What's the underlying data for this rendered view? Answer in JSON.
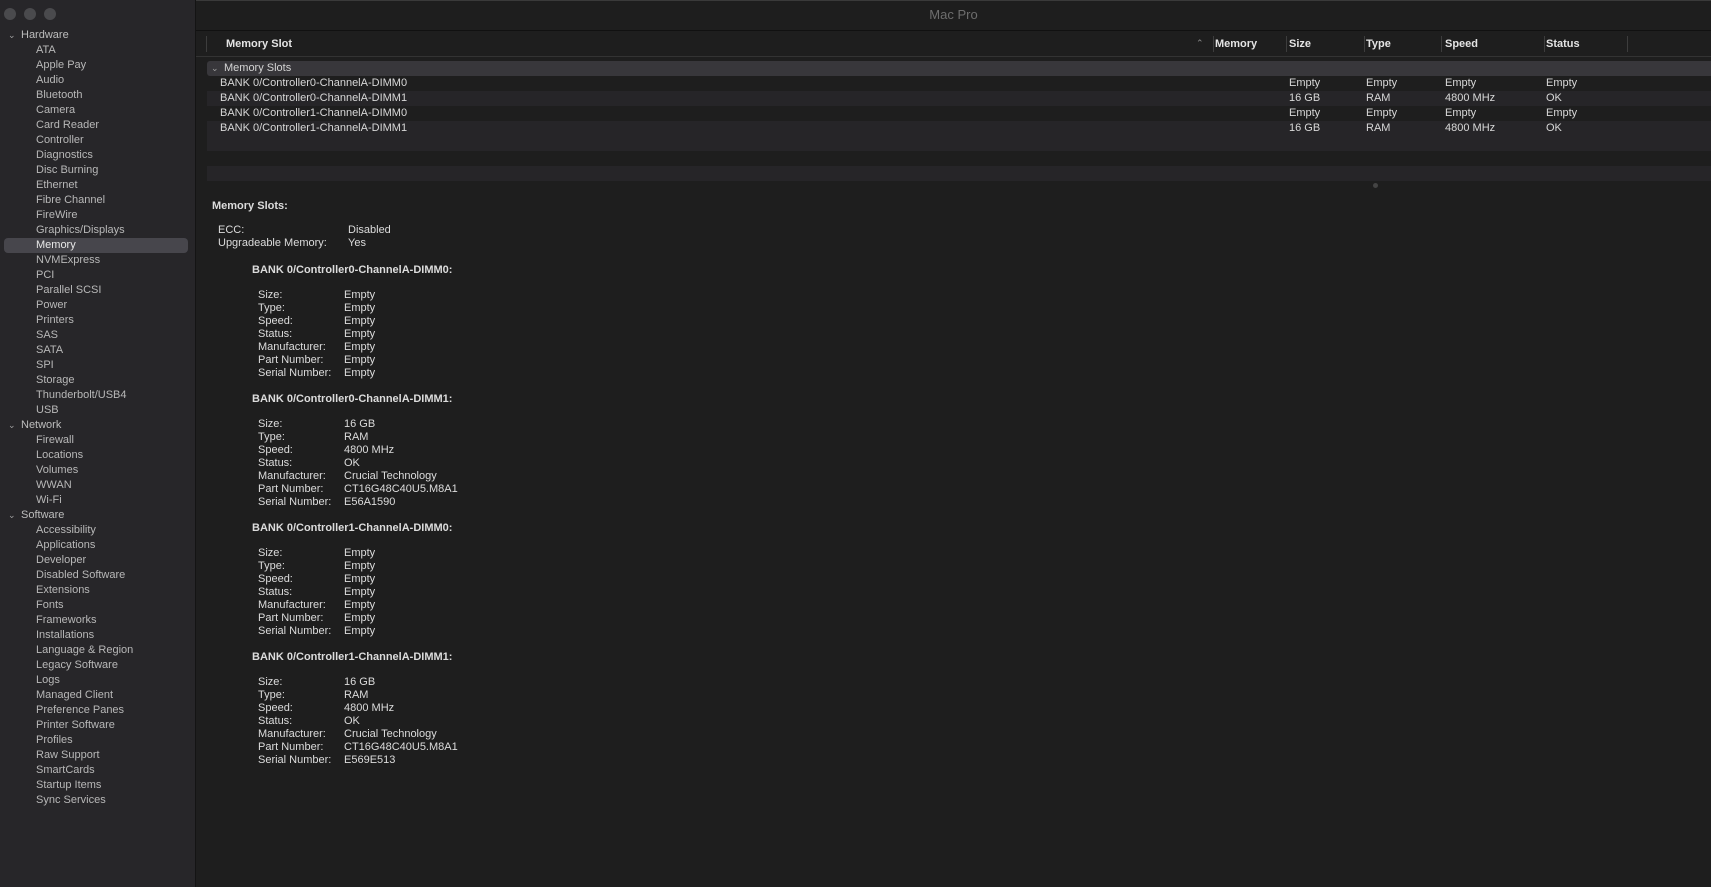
{
  "window": {
    "title": "Mac Pro"
  },
  "sidebar": {
    "sections": [
      {
        "label": "Hardware",
        "items": [
          "ATA",
          "Apple Pay",
          "Audio",
          "Bluetooth",
          "Camera",
          "Card Reader",
          "Controller",
          "Diagnostics",
          "Disc Burning",
          "Ethernet",
          "Fibre Channel",
          "FireWire",
          "Graphics/Displays",
          "Memory",
          "NVMExpress",
          "PCI",
          "Parallel SCSI",
          "Power",
          "Printers",
          "SAS",
          "SATA",
          "SPI",
          "Storage",
          "Thunderbolt/USB4",
          "USB"
        ]
      },
      {
        "label": "Network",
        "items": [
          "Firewall",
          "Locations",
          "Volumes",
          "WWAN",
          "Wi-Fi"
        ]
      },
      {
        "label": "Software",
        "items": [
          "Accessibility",
          "Applications",
          "Developer",
          "Disabled Software",
          "Extensions",
          "Fonts",
          "Frameworks",
          "Installations",
          "Language & Region",
          "Legacy Software",
          "Logs",
          "Managed Client",
          "Preference Panes",
          "Printer Software",
          "Profiles",
          "Raw Support",
          "SmartCards",
          "Startup Items",
          "Sync Services"
        ]
      }
    ],
    "selected": "Memory"
  },
  "table": {
    "columns": [
      "Memory Slot",
      "Memory",
      "Size",
      "Type",
      "Speed",
      "Status"
    ],
    "group_label": "Memory Slots",
    "rows": [
      {
        "slot": "BANK 0/Controller0-ChannelA-DIMM0",
        "memory": "",
        "size": "Empty",
        "type": "Empty",
        "speed": "Empty",
        "status": "Empty"
      },
      {
        "slot": "BANK 0/Controller0-ChannelA-DIMM1",
        "memory": "",
        "size": "16 GB",
        "type": "RAM",
        "speed": "4800 MHz",
        "status": "OK"
      },
      {
        "slot": "BANK 0/Controller1-ChannelA-DIMM0",
        "memory": "",
        "size": "Empty",
        "type": "Empty",
        "speed": "Empty",
        "status": "Empty"
      },
      {
        "slot": "BANK 0/Controller1-ChannelA-DIMM1",
        "memory": "",
        "size": "16 GB",
        "type": "RAM",
        "speed": "4800 MHz",
        "status": "OK"
      }
    ]
  },
  "detail": {
    "heading": "Memory Slots:",
    "summary": [
      {
        "key": "ECC:",
        "value": "Disabled"
      },
      {
        "key": "Upgradeable Memory:",
        "value": "Yes"
      }
    ],
    "banks": [
      {
        "name": "BANK 0/Controller0-ChannelA-DIMM0:",
        "fields": [
          {
            "key": "Size:",
            "value": "Empty"
          },
          {
            "key": "Type:",
            "value": "Empty"
          },
          {
            "key": "Speed:",
            "value": "Empty"
          },
          {
            "key": "Status:",
            "value": "Empty"
          },
          {
            "key": "Manufacturer:",
            "value": "Empty"
          },
          {
            "key": "Part Number:",
            "value": "Empty"
          },
          {
            "key": "Serial Number:",
            "value": "Empty"
          }
        ]
      },
      {
        "name": "BANK 0/Controller0-ChannelA-DIMM1:",
        "fields": [
          {
            "key": "Size:",
            "value": "16 GB"
          },
          {
            "key": "Type:",
            "value": "RAM"
          },
          {
            "key": "Speed:",
            "value": "4800 MHz"
          },
          {
            "key": "Status:",
            "value": "OK"
          },
          {
            "key": "Manufacturer:",
            "value": "Crucial Technology"
          },
          {
            "key": "Part Number:",
            "value": "CT16G48C40U5.M8A1"
          },
          {
            "key": "Serial Number:",
            "value": "E56A1590"
          }
        ]
      },
      {
        "name": "BANK 0/Controller1-ChannelA-DIMM0:",
        "fields": [
          {
            "key": "Size:",
            "value": "Empty"
          },
          {
            "key": "Type:",
            "value": "Empty"
          },
          {
            "key": "Speed:",
            "value": "Empty"
          },
          {
            "key": "Status:",
            "value": "Empty"
          },
          {
            "key": "Manufacturer:",
            "value": "Empty"
          },
          {
            "key": "Part Number:",
            "value": "Empty"
          },
          {
            "key": "Serial Number:",
            "value": "Empty"
          }
        ]
      },
      {
        "name": "BANK 0/Controller1-ChannelA-DIMM1:",
        "fields": [
          {
            "key": "Size:",
            "value": "16 GB"
          },
          {
            "key": "Type:",
            "value": "RAM"
          },
          {
            "key": "Speed:",
            "value": "4800 MHz"
          },
          {
            "key": "Status:",
            "value": "OK"
          },
          {
            "key": "Manufacturer:",
            "value": "Crucial Technology"
          },
          {
            "key": "Part Number:",
            "value": "CT16G48C40U5.M8A1"
          },
          {
            "key": "Serial Number:",
            "value": "E569E513"
          }
        ]
      }
    ]
  },
  "icons": {
    "expand": "chevron-down-icon",
    "sort": "chevron-up-icon"
  }
}
